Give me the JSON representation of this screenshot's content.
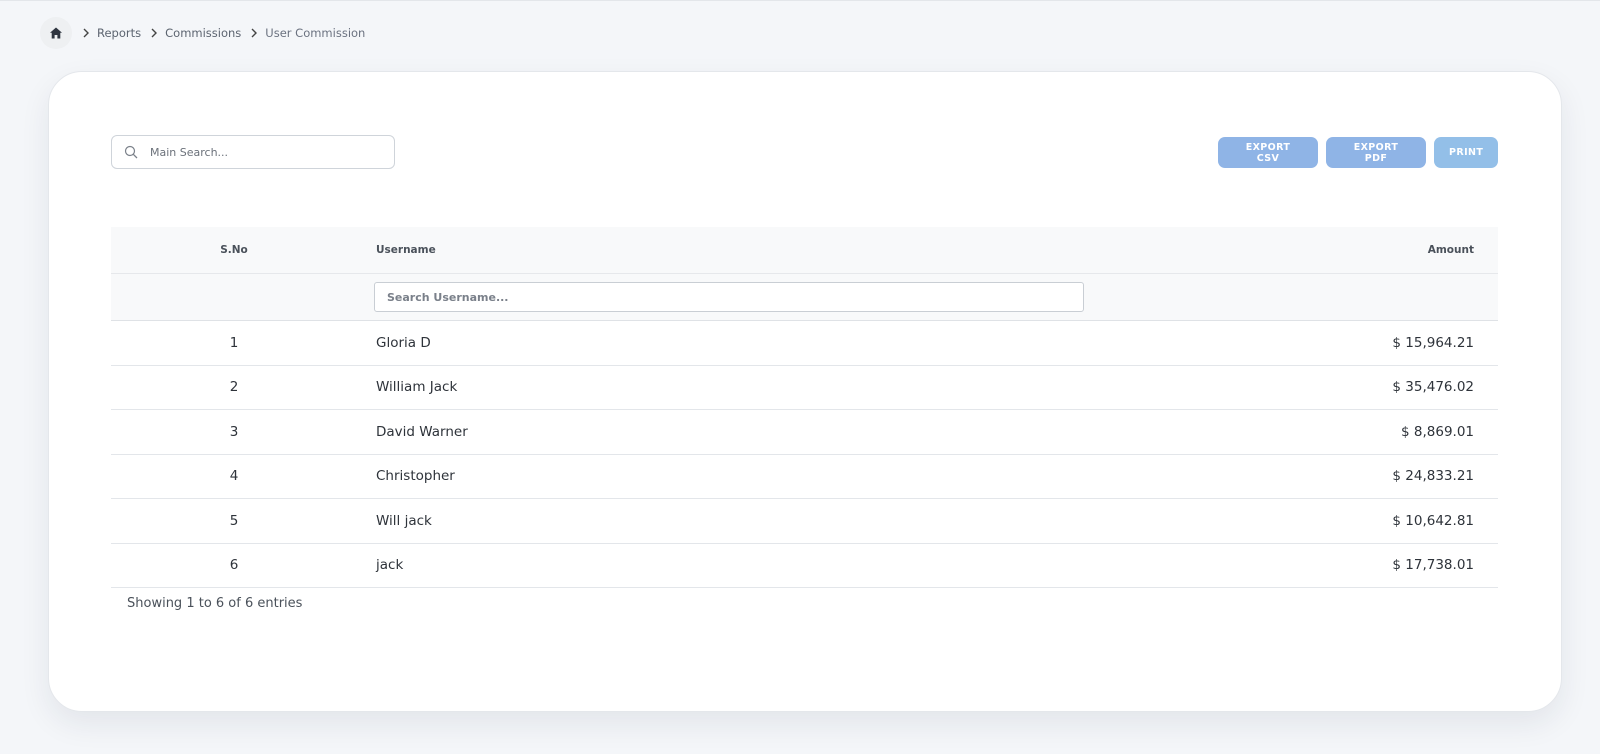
{
  "breadcrumb": {
    "items": [
      "Reports",
      "Commissions",
      "User Commission"
    ]
  },
  "search": {
    "placeholder": "Main Search..."
  },
  "actions": {
    "export_csv": "EXPORT CSV",
    "export_pdf": "EXPORT PDF",
    "print": "PRINT"
  },
  "table": {
    "headers": {
      "sno": "S.No",
      "username": "Username",
      "amount": "Amount"
    },
    "filter_placeholder": "Search Username...",
    "rows": [
      {
        "sno": "1",
        "username": "Gloria D",
        "amount": "$ 15,964.21"
      },
      {
        "sno": "2",
        "username": "William Jack",
        "amount": "$ 35,476.02"
      },
      {
        "sno": "3",
        "username": "David Warner",
        "amount": "$ 8,869.01"
      },
      {
        "sno": "4",
        "username": "Christopher",
        "amount": "$ 24,833.21"
      },
      {
        "sno": "5",
        "username": "Will jack",
        "amount": "$ 10,642.81"
      },
      {
        "sno": "6",
        "username": "jack",
        "amount": "$ 17,738.01"
      }
    ],
    "info": "Showing 1 to 6 of 6 entries"
  },
  "colors": {
    "button": "#8fb4e6",
    "header_bg": "#f8f9fa"
  },
  "icons": [
    "home-icon",
    "chevron-right-icon",
    "search-icon"
  ]
}
